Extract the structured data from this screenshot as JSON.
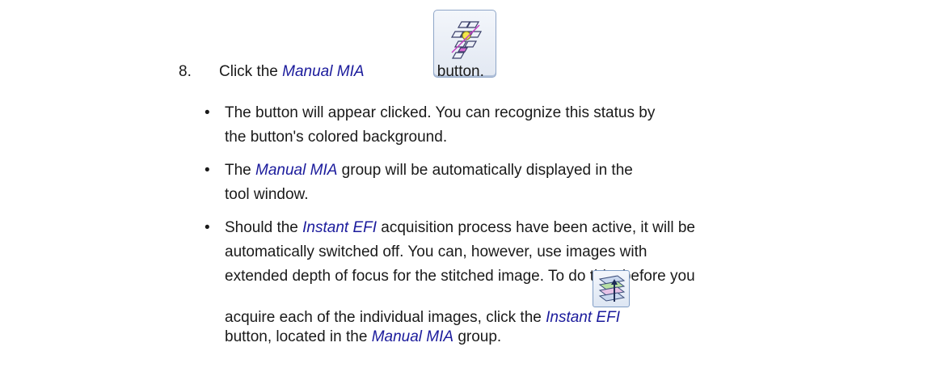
{
  "step": {
    "number": "8.",
    "pre": "Click the ",
    "name": "Manual MIA",
    "post": " button.",
    "icon": "manual-mia-icon"
  },
  "bullets": [
    {
      "text": "The button will appear clicked. You can recognize this status by the button's colored background."
    },
    {
      "name": "Manual MIA",
      "text": " group will be automatically displayed in the tool window.",
      "pre": "The "
    },
    {
      "pre": "Should the ",
      "name": "Instant EFI",
      "text1": " acquisition process have been active, it will be",
      "line2": "automatically switched off. You can, however, use images with",
      "line3": "extended depth of focus for the stitched image. To do this, before you",
      "line4_pre": "acquire each of the individual images, click the ",
      "line4_name": "Instant EFI",
      "line5_pre": "button, located in the ",
      "line5_name": "Manual MIA",
      "line5_post": " group.",
      "icon": "instant-efi-icon"
    }
  ],
  "bullet_symbol": "•",
  "colors": {
    "link": "#1b1b9c",
    "text": "#1a1a1a"
  }
}
